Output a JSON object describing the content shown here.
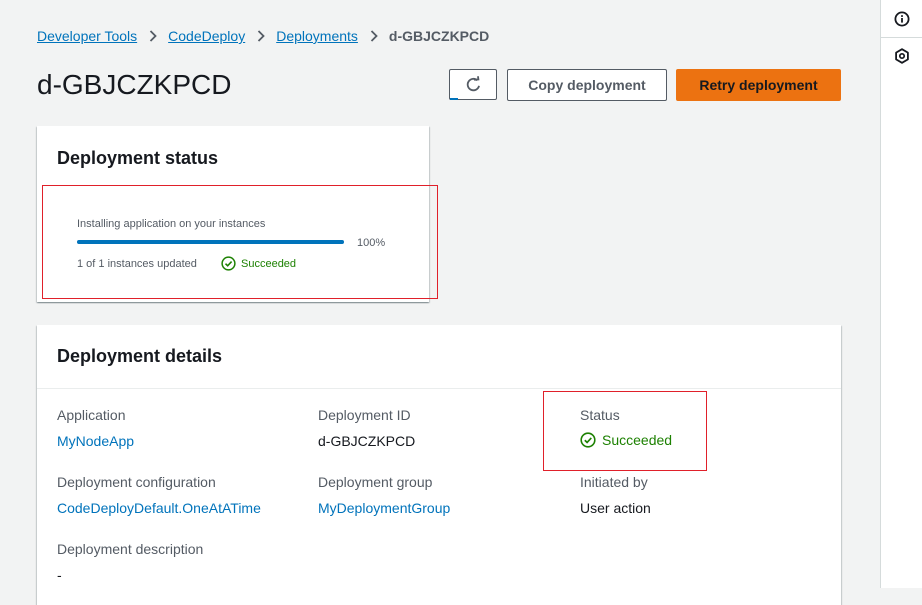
{
  "breadcrumb": {
    "items": [
      "Developer Tools",
      "CodeDeploy",
      "Deployments"
    ],
    "current": "d-GBJCZKPCD"
  },
  "header": {
    "title": "d-GBJCZKPCD",
    "refresh_icon": "refresh-icon",
    "copy_label": "Copy deployment",
    "retry_label": "Retry deployment"
  },
  "status_panel": {
    "title": "Deployment status",
    "progress_label": "Installing application on your instances",
    "progress_value": 1.0,
    "progress_percent": "100%",
    "instances_text": "1 of 1 instances updated",
    "status": "Succeeded"
  },
  "details": {
    "title": "Deployment details",
    "application_label": "Application",
    "application_value": "MyNodeApp",
    "deployment_id_label": "Deployment ID",
    "deployment_id_value": "d-GBJCZKPCD",
    "status_label": "Status",
    "status_value": "Succeeded",
    "config_label": "Deployment configuration",
    "config_value": "CodeDeployDefault.OneAtATime",
    "group_label": "Deployment group",
    "group_value": "MyDeploymentGroup",
    "initiated_label": "Initiated by",
    "initiated_value": "User action",
    "description_label": "Deployment description",
    "description_value": "-"
  },
  "right_rail": {
    "icons": [
      "info-icon",
      "tools-icon"
    ]
  },
  "colors": {
    "link": "#0073bb",
    "primary_button": "#ec7211",
    "success": "#1d8102",
    "highlight": "#e0202a"
  }
}
